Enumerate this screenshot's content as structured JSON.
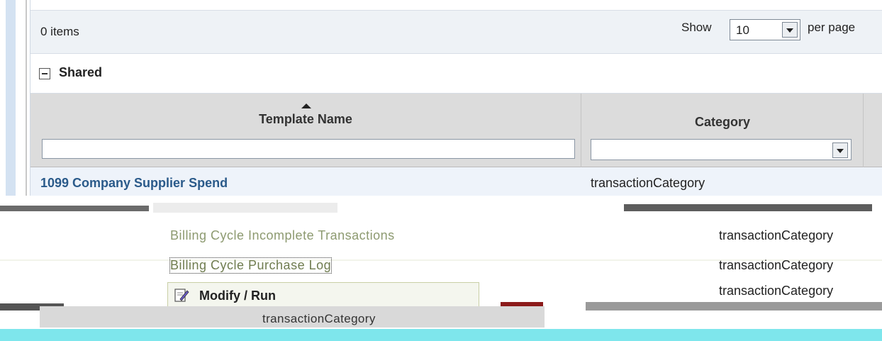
{
  "toolbar": {
    "items_count": "0 items",
    "show_label": "Show",
    "page_size": "10",
    "per_page_label": "per page"
  },
  "section": {
    "label": "Shared"
  },
  "grid": {
    "columns": [
      "Template Name",
      "Category"
    ],
    "filter_name_value": "",
    "filter_category_value": ""
  },
  "rows": [
    {
      "name": "1099 Company Supplier Spend",
      "category": "transactionCategory"
    }
  ],
  "glitched_rows": [
    {
      "name": "Billing Cycle Incomplete Transactions",
      "category": "transactionCategory"
    },
    {
      "name": "Billing Cycle Purchase Log",
      "category": "transactionCategory"
    },
    {
      "name": "",
      "category": "transactionCategory"
    }
  ],
  "context_menu": {
    "item_label": "Modify / Run"
  },
  "overlay_text": "transactionCategory",
  "colors": {
    "header_bg": "#dcdcdc",
    "link": "#2a5a8a",
    "highlight_row": "#eef3fa",
    "artifact_cyan": "#7ee6ec"
  }
}
